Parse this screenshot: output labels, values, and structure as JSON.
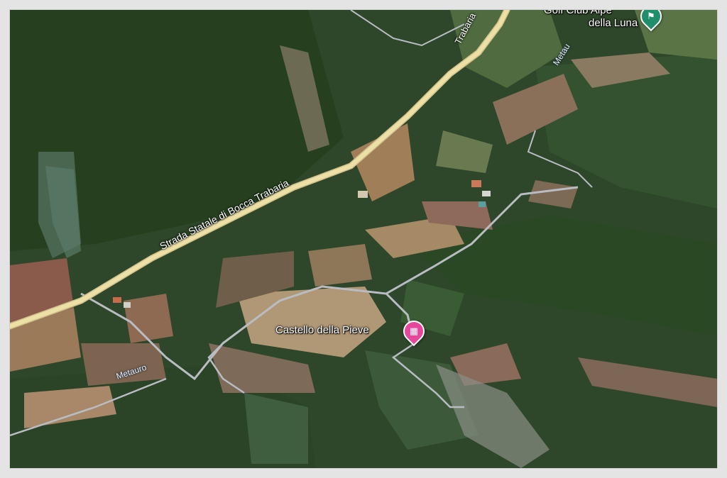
{
  "map": {
    "type": "satellite",
    "colors": {
      "forest": "#2f4a2a",
      "field_brown": "#8a6e54",
      "field_tan": "#a89072",
      "main_road": "#e8d79a",
      "minor_road": "#b8bcc4",
      "hotel_pin": "#e6479a",
      "golf_pin": "#1e8e6b"
    }
  },
  "roads": {
    "main_road_label": "Strada Statale di Bocca Trabaria",
    "main_road_label_cont": "Trabaria"
  },
  "rivers": {
    "label_lower": "Metauro",
    "label_upper": "Metau"
  },
  "places": {
    "castello": {
      "label": "Castello della Pieve",
      "icon": "hotel-bed-icon"
    },
    "golf": {
      "label_line1": "Golf Club Alpe",
      "label_line2": "della Luna",
      "icon": "golf-flag-icon"
    }
  }
}
